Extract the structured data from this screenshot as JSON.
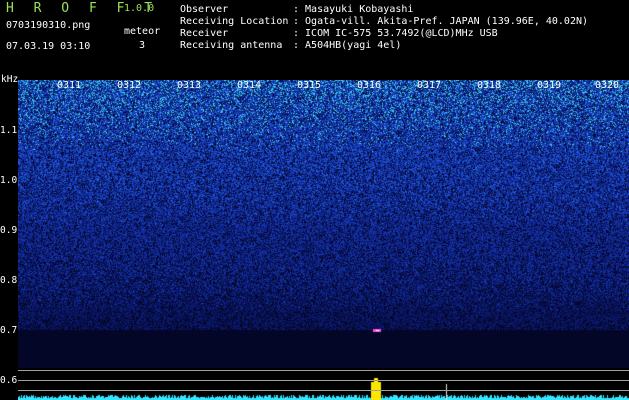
{
  "header": {
    "app_name": "H R O F F T",
    "version": "1.0.0",
    "filename": "0703190310.png",
    "datetime": "07.03.19 03:10",
    "count_label": "meteor",
    "count_value": "3"
  },
  "meta": [
    {
      "key": "Observer",
      "value": ": Masayuki Kobayashi"
    },
    {
      "key": "Receiving Location",
      "value": ": Ogata-vill. Akita-Pref. JAPAN (139.96E, 40.02N)"
    },
    {
      "key": "Receiver",
      "value": ": ICOM IC-575 53.7492(@LCD)MHz USB"
    },
    {
      "key": "Receiving antenna",
      "value": ": A504HB(yagi 4el)"
    }
  ],
  "y_axis": {
    "unit": "kHz",
    "ticks": [
      "1.1",
      "1.0",
      "0.9",
      "0.8",
      "0.7",
      "0.6"
    ]
  },
  "time_ticks": [
    "0311",
    "0312",
    "0313",
    "0314",
    "0315",
    "0316",
    "0317",
    "0318",
    "0319",
    "0320"
  ],
  "colors": {
    "title": "#9be25a",
    "noise_dark": "#05082a",
    "noise_mid": "#1838b8",
    "noise_bright": "#39d8e6",
    "meteor_echo": "#ff4fe6",
    "spectrum": "#34e6ff",
    "peak": "#ffe600"
  }
}
